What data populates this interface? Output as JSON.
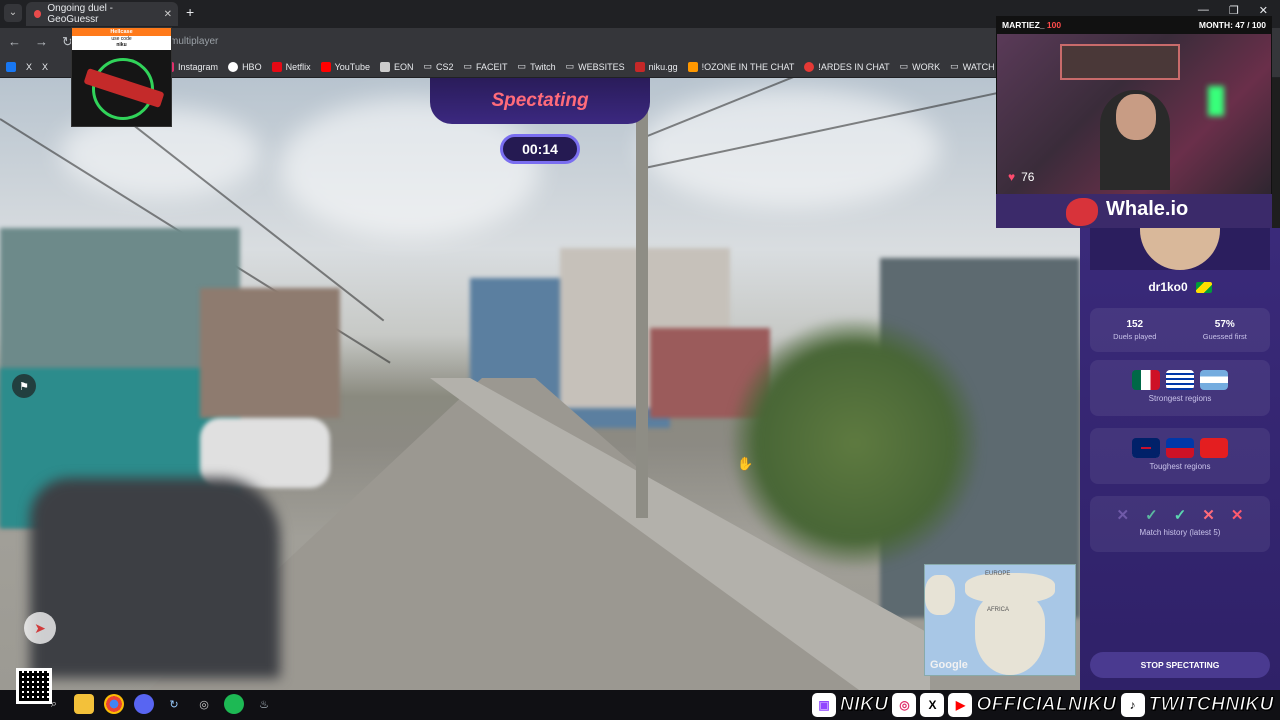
{
  "browser": {
    "tab_title": "Ongoing duel - GeoGuessr",
    "url": "multiplayer",
    "bookmarks": [
      {
        "label": "Instagram",
        "color": "#e1306c"
      },
      {
        "label": "HBO",
        "color": "#ffffff"
      },
      {
        "label": "Netflix",
        "color": "#e50914"
      },
      {
        "label": "YouTube",
        "color": "#ff0000"
      },
      {
        "label": "EON",
        "color": "#cccccc"
      },
      {
        "label": "CS2",
        "color": "#9aa0a6"
      },
      {
        "label": "FACEIT",
        "color": "#9aa0a6"
      },
      {
        "label": "Twitch",
        "color": "#9aa0a6"
      },
      {
        "label": "WEBSITES",
        "color": "#9aa0a6"
      },
      {
        "label": "niku.gg",
        "color": "#c62828"
      },
      {
        "label": "!OZONE IN THE CHAT",
        "color": "#ff9800"
      },
      {
        "label": "!ARDES IN CHAT",
        "color": "#e53935"
      },
      {
        "label": "WORK",
        "color": "#9aa0a6"
      },
      {
        "label": "WATCH LATER",
        "color": "#9aa0a6"
      }
    ]
  },
  "game": {
    "spectating_label": "Spectating",
    "timer": "00:14",
    "stop_button": "STOP SPECTATING",
    "minimap_google": "Google",
    "minimap_labels": {
      "europe": "EUROPE",
      "africa": "AFRICA"
    }
  },
  "player": {
    "username": "dr1ko0",
    "stats": [
      {
        "value": "152",
        "label": "Duels played"
      },
      {
        "value": "57%",
        "label": "Guessed first"
      }
    ],
    "strongest_label": "Strongest regions",
    "toughest_label": "Toughest regions",
    "history_label": "Match history (latest 5)",
    "history": [
      {
        "symbol": "✕",
        "color": "#6f5aa8"
      },
      {
        "symbol": "✓",
        "color": "#5bb8a0"
      },
      {
        "symbol": "✓",
        "color": "#5bd6b0"
      },
      {
        "symbol": "✕",
        "color": "#ff6b7a"
      },
      {
        "symbol": "✕",
        "color": "#ff5a6e"
      }
    ]
  },
  "stream": {
    "viewer_name": "MARTIEZ_",
    "viewer_amount": "100",
    "month_goal": "MONTH: 47 / 100",
    "heart_rate": "76",
    "sponsor_title": "Whale.io",
    "sponsor_box_brand": "Hellcase",
    "sponsor_box_code": "use code",
    "sponsor_box_name": "niku",
    "socials": [
      {
        "icon": "twitch-icon",
        "glyph": "▣",
        "handle": "NIKU"
      },
      {
        "icon": "instagram-icon",
        "glyph": "◎",
        "handle": ""
      },
      {
        "icon": "x-icon",
        "glyph": "X",
        "handle": ""
      },
      {
        "icon": "youtube-icon",
        "glyph": "▶",
        "handle": "OFFICIALNIKU"
      },
      {
        "icon": "tiktok-icon",
        "glyph": "♪",
        "handle": "TWITCHNIKU"
      }
    ]
  }
}
